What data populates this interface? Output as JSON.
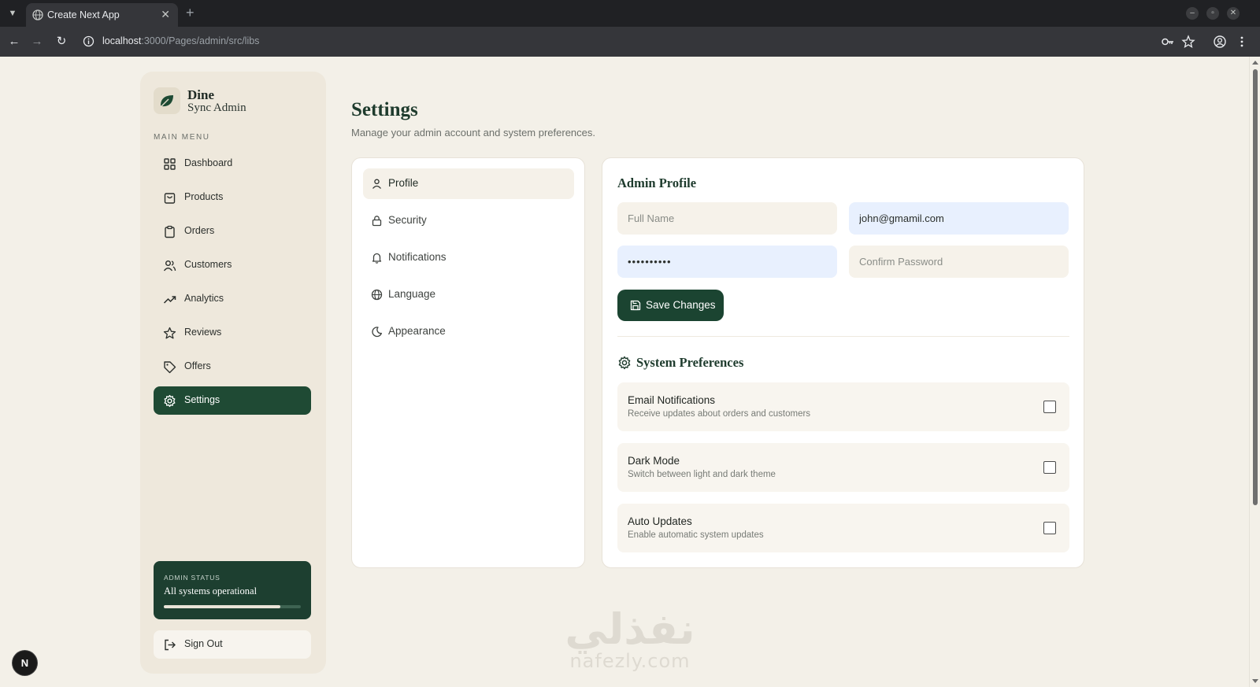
{
  "browser": {
    "tab_title": "Create Next App",
    "url_host": "localhost",
    "url_path": ":3000/Pages/admin/src/libs"
  },
  "sidebar": {
    "brand_name": "Dine",
    "brand_sub": "Sync Admin",
    "menu_label": "MAIN MENU",
    "items": [
      {
        "label": "Dashboard",
        "icon": "grid-icon"
      },
      {
        "label": "Products",
        "icon": "shopping-bag-icon"
      },
      {
        "label": "Orders",
        "icon": "clipboard-icon"
      },
      {
        "label": "Customers",
        "icon": "users-icon"
      },
      {
        "label": "Analytics",
        "icon": "trending-up-icon"
      },
      {
        "label": "Reviews",
        "icon": "star-icon"
      },
      {
        "label": "Offers",
        "icon": "tag-icon"
      },
      {
        "label": "Settings",
        "icon": "gear-icon"
      }
    ],
    "active_item": "Settings",
    "status_label": "ADMIN STATUS",
    "status_text": "All systems operational",
    "status_progress": 0.85,
    "sign_out_label": "Sign Out"
  },
  "main": {
    "title": "Settings",
    "subtitle": "Manage your admin account and system preferences.",
    "tabs": [
      {
        "label": "Profile",
        "icon": "user-icon"
      },
      {
        "label": "Security",
        "icon": "lock-icon"
      },
      {
        "label": "Notifications",
        "icon": "bell-icon"
      },
      {
        "label": "Language",
        "icon": "globe-icon"
      },
      {
        "label": "Appearance",
        "icon": "moon-icon"
      }
    ],
    "active_tab": "Profile"
  },
  "profile": {
    "title": "Admin Profile",
    "full_name_placeholder": "Full Name",
    "full_name_value": "",
    "email_value": "john@gmamil.com",
    "password_value": "••••••••••",
    "confirm_password_placeholder": "Confirm Password",
    "save_label": "Save Changes"
  },
  "preferences": {
    "title": "System Preferences",
    "items": [
      {
        "title": "Email Notifications",
        "desc": "Receive updates about orders and customers",
        "checked": false
      },
      {
        "title": "Dark Mode",
        "desc": "Switch between light and dark theme",
        "checked": false
      },
      {
        "title": "Auto Updates",
        "desc": "Enable automatic system updates",
        "checked": false
      }
    ]
  },
  "watermark": {
    "arabic": "نفذلي",
    "latin": "nafezly.com"
  },
  "next_badge": "N",
  "colors": {
    "accent": "#1f4a34",
    "page_bg": "#f3f0e8",
    "sidebar_bg": "#eee8dc"
  }
}
